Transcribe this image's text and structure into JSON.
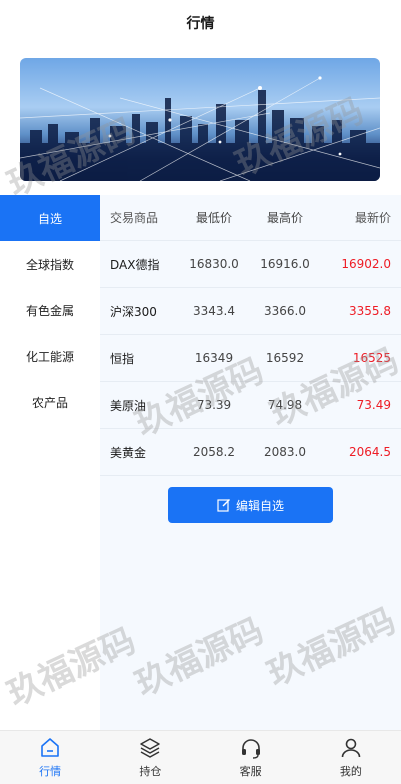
{
  "header": {
    "title": "行情"
  },
  "sidebar": {
    "items": [
      {
        "label": "自选"
      },
      {
        "label": "全球指数"
      },
      {
        "label": "有色金属"
      },
      {
        "label": "化工能源"
      },
      {
        "label": "农产品"
      }
    ]
  },
  "table": {
    "headers": {
      "name": "交易商品",
      "low": "最低价",
      "high": "最高价",
      "last": "最新价"
    },
    "rows": [
      {
        "name": "DAX德指",
        "low": "16830.0",
        "high": "16916.0",
        "last": "16902.0"
      },
      {
        "name": "沪深300",
        "low": "3343.4",
        "high": "3366.0",
        "last": "3355.8"
      },
      {
        "name": "恒指",
        "low": "16349",
        "high": "16592",
        "last": "16525"
      },
      {
        "name": "美原油",
        "low": "73.39",
        "high": "74.98",
        "last": "73.49"
      },
      {
        "name": "美黄金",
        "low": "2058.2",
        "high": "2083.0",
        "last": "2064.5"
      }
    ]
  },
  "edit_button": {
    "label": "编辑自选"
  },
  "tabbar": {
    "tabs": [
      {
        "label": "行情"
      },
      {
        "label": "持仓"
      },
      {
        "label": "客服"
      },
      {
        "label": "我的"
      }
    ]
  },
  "watermark": {
    "text": "玖福源码"
  },
  "colors": {
    "accent": "#1a73f5",
    "price_red": "#ee1c25"
  }
}
